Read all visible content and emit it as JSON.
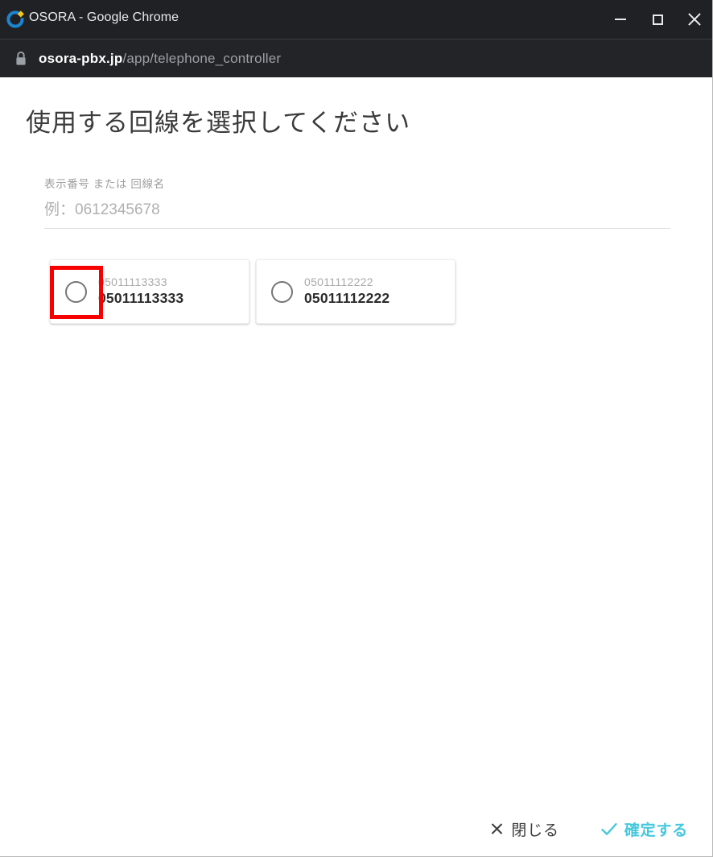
{
  "window": {
    "title": "OSORA - Google Chrome",
    "favicon_name": "osora-logo-icon",
    "controls": {
      "minimize_label": "minimize",
      "maximize_label": "maximize",
      "close_label": "close"
    }
  },
  "urlbar": {
    "lock_icon": "lock-icon",
    "domain": "osora-pbx.jp",
    "path": "/app/telephone_controller"
  },
  "page": {
    "title": "使用する回線を選択してください",
    "filter": {
      "label": "表示番号 または 回線名",
      "value": "",
      "placeholder": "例：0612345678"
    },
    "line_cards": [
      {
        "sub": "05011113333",
        "main": "05011113333",
        "selected": false,
        "highlighted": true
      },
      {
        "sub": "05011112222",
        "main": "05011112222",
        "selected": false,
        "highlighted": false
      }
    ],
    "actions": {
      "cancel_label": "閉じる",
      "confirm_label": "確定する"
    }
  },
  "colors": {
    "titlebar_bg": "#202124",
    "urlbar_bg": "#232427",
    "accent_cyan": "#45c8dc",
    "annotation_red": "#f60000",
    "page_bg": "#ffffff"
  }
}
